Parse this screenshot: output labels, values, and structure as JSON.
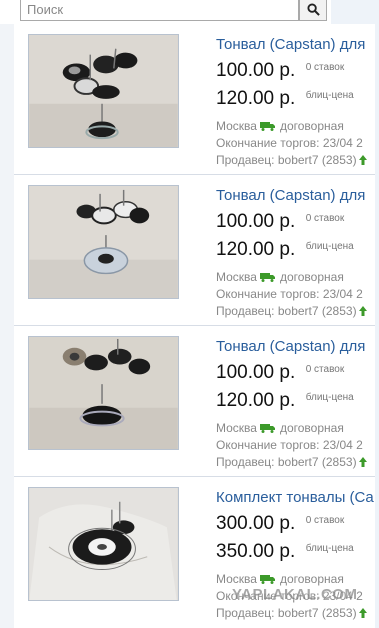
{
  "search": {
    "placeholder": "Поиск"
  },
  "items": [
    {
      "title": "Тонвал (Capstan) для",
      "price": "100.00 р.",
      "bids": "0 ставок",
      "buyout_price": "120.00 р.",
      "buyout_label": "блиц-цена",
      "city": "Москва",
      "delivery": "договорная",
      "ends": "Окончание торгов: 23/04 2",
      "seller": "Продавец: bobert7 (2853)"
    },
    {
      "title": "Тонвал (Capstan) для",
      "price": "100.00 р.",
      "bids": "0 ставок",
      "buyout_price": "120.00 р.",
      "buyout_label": "блиц-цена",
      "city": "Москва",
      "delivery": "договорная",
      "ends": "Окончание торгов: 23/04 2",
      "seller": "Продавец: bobert7 (2853)"
    },
    {
      "title": "Тонвал (Capstan) для",
      "price": "100.00 р.",
      "bids": "0 ставок",
      "buyout_price": "120.00 р.",
      "buyout_label": "блиц-цена",
      "city": "Москва",
      "delivery": "договорная",
      "ends": "Окончание торгов: 23/04 2",
      "seller": "Продавец: bobert7 (2853)"
    },
    {
      "title": "Комплект тонвалы (Ca",
      "price": "300.00 р.",
      "bids": "0 ставок",
      "buyout_price": "350.00 р.",
      "buyout_label": "блиц-цена",
      "city": "Москва",
      "delivery": "договорная",
      "ends": "Окончание торгов: 23/04 2",
      "seller": "Продавец: bobert7 (2853)"
    }
  ],
  "watermark": "YAPLAKAL.COM",
  "colors": {
    "link": "#2a5e9c",
    "truck": "#3c9a2a",
    "feedback": "#3c9a2a"
  },
  "icons": {
    "search": "magnifier-icon",
    "delivery": "truck-icon",
    "feedback": "up-arrow-icon"
  }
}
